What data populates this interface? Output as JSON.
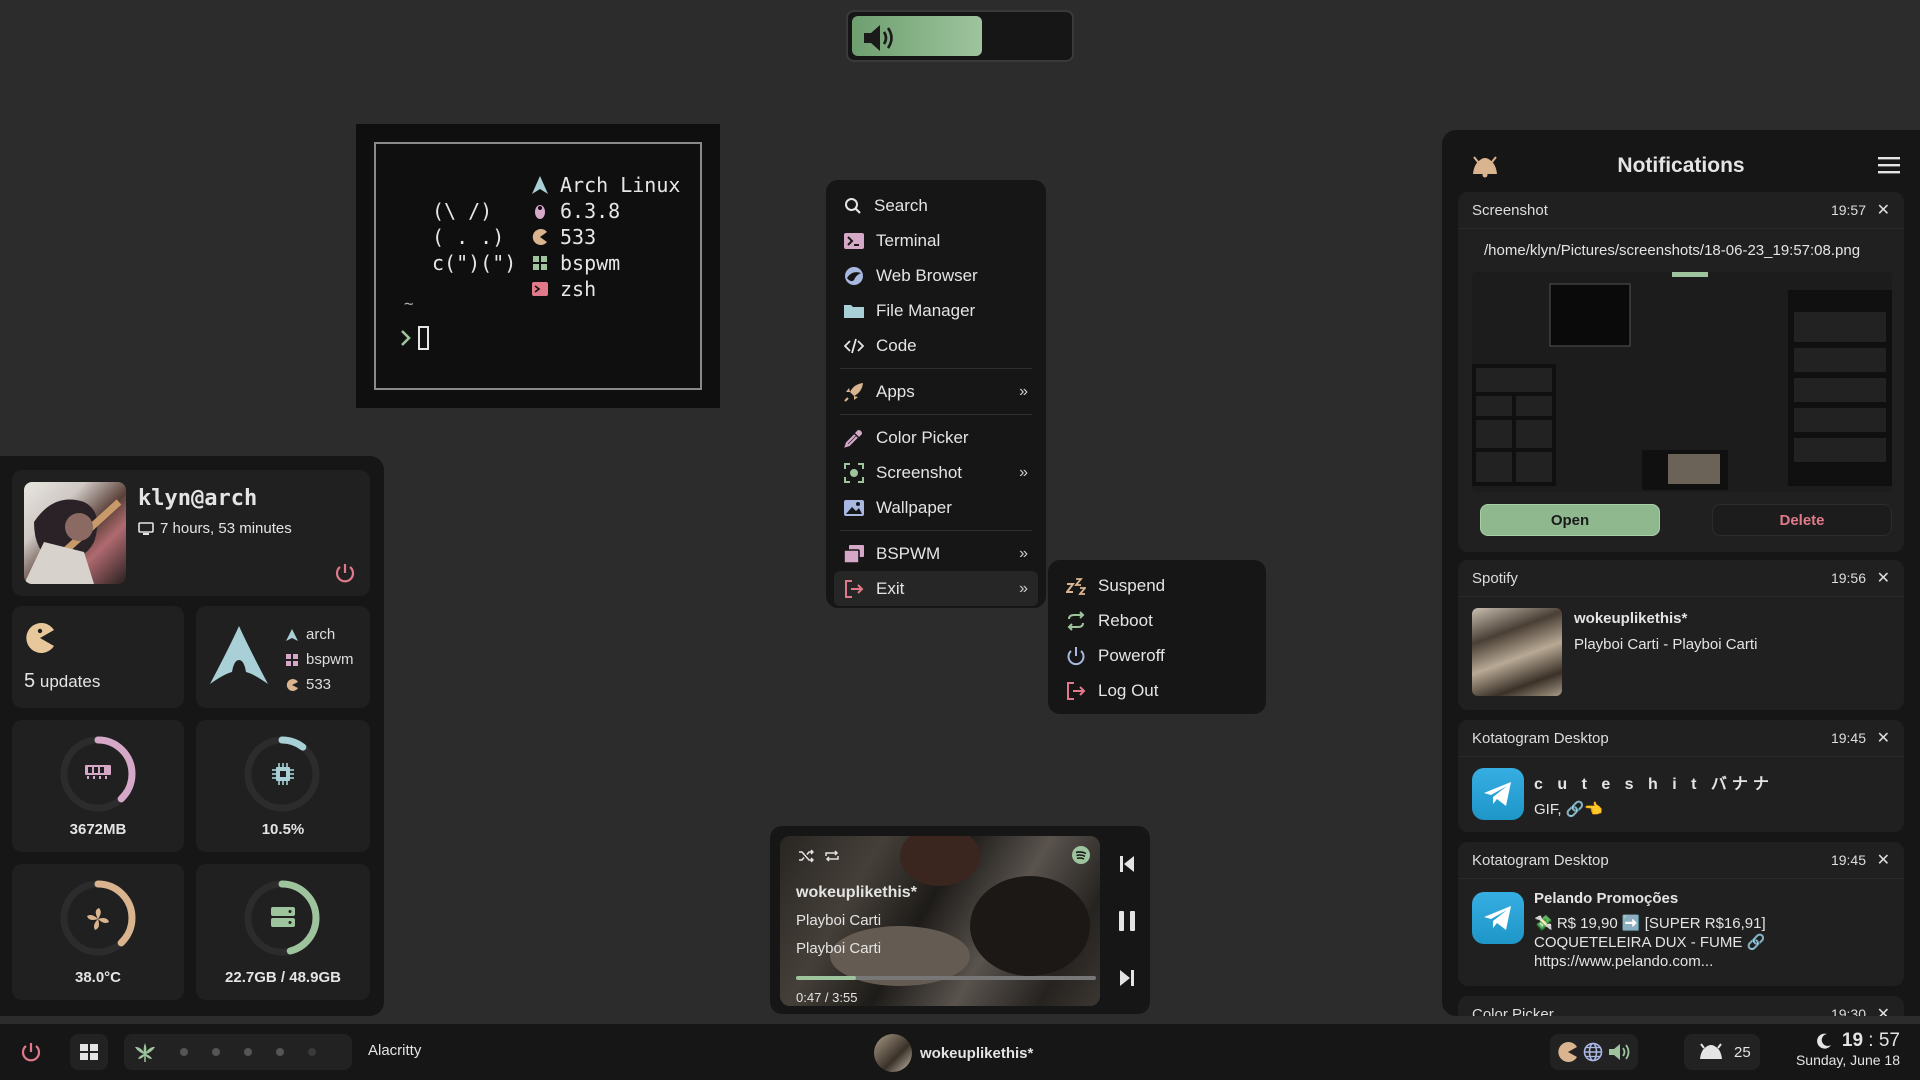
{
  "volume_osd": {
    "level": 0.6,
    "icon": "speaker-icon",
    "color": "#9ec49e"
  },
  "terminal": {
    "bunny": [
      "(\\ /)",
      "( . .)",
      "c(\")(\")"
    ],
    "info": [
      {
        "icon": "arch-icon",
        "text": "Arch Linux"
      },
      {
        "icon": "kernel-icon",
        "text": "6.3.8"
      },
      {
        "icon": "package-icon",
        "text": "533"
      },
      {
        "icon": "wm-icon",
        "text": "bspwm"
      },
      {
        "icon": "shell-icon",
        "text": "zsh"
      }
    ],
    "cwd": "~",
    "prompt": ">"
  },
  "profile": {
    "username": "klyn@arch",
    "uptime": "7 hours, 53 minutes"
  },
  "updates": {
    "count": "5",
    "label": "updates"
  },
  "sysinfo": {
    "distro": "arch",
    "wm": "bspwm",
    "packages": "533"
  },
  "gauges": {
    "ram": {
      "value": "3672MB",
      "percent": 0.38,
      "color": "#d6a8c8"
    },
    "cpu": {
      "value": "10.5%",
      "percent": 0.105,
      "color": "#a8d0d6"
    },
    "temp": {
      "value": "38.0°C",
      "percent": 0.38,
      "color": "#d9b48f"
    },
    "disk": {
      "value": "22.7GB / 48.9GB",
      "percent": 0.46,
      "color": "#9ec49e"
    }
  },
  "menu": {
    "items": [
      {
        "label": "Search",
        "icon": "search-icon"
      },
      {
        "label": "Terminal",
        "icon": "terminal-icon"
      },
      {
        "label": "Web Browser",
        "icon": "browser-icon"
      },
      {
        "label": "File Manager",
        "icon": "folder-icon"
      },
      {
        "label": "Code",
        "icon": "code-icon"
      },
      {
        "label": "Apps",
        "icon": "rocket-icon",
        "submenu": true
      },
      {
        "label": "Color Picker",
        "icon": "eyedropper-icon"
      },
      {
        "label": "Screenshot",
        "icon": "screenshot-icon",
        "submenu": true
      },
      {
        "label": "Wallpaper",
        "icon": "image-icon"
      },
      {
        "label": "BSPWM",
        "icon": "windows-icon",
        "submenu": true
      },
      {
        "label": "Exit",
        "icon": "exit-icon",
        "submenu": true
      }
    ],
    "arrow": "»"
  },
  "exit_menu": {
    "items": [
      {
        "label": "Suspend",
        "icon": "sleep-icon"
      },
      {
        "label": "Reboot",
        "icon": "reboot-icon"
      },
      {
        "label": "Poweroff",
        "icon": "power-icon"
      },
      {
        "label": "Log Out",
        "icon": "logout-icon"
      }
    ]
  },
  "music": {
    "title": "wokeuplikethis*",
    "artist": "Playboi Carti",
    "album": "Playboi Carti",
    "time": "0:47 / 3:55",
    "progress": 0.2
  },
  "notifications": {
    "title": "Notifications",
    "items": [
      {
        "app": "Screenshot",
        "time": "19:57",
        "body": "/home/klyn/Pictures/screenshots/18-06-23_19:57:08.png",
        "open": "Open",
        "delete": "Delete"
      },
      {
        "app": "Spotify",
        "time": "19:56",
        "title": "wokeuplikethis*",
        "body": "Playboi Carti - Playboi Carti"
      },
      {
        "app": "Kotatogram Desktop",
        "time": "19:45",
        "title": "c u t e s h i t バナナ",
        "body": "GIF, 🔗👈"
      },
      {
        "app": "Kotatogram Desktop",
        "time": "19:45",
        "title": "Pelando Promoções",
        "body": "💸 R$ 19,90 ➡️ [SUPER R$16,91] COQUETELEIRA DUX - FUME 🔗 https://www.pelando.com..."
      },
      {
        "app": "Color Picker",
        "time": "19:30"
      }
    ],
    "close": "✕"
  },
  "taskbar": {
    "window_title": "Alacritty",
    "now_playing": "wokeuplikethis*",
    "notif_count": "25",
    "time_h": "19",
    "time_m": "57",
    "date": "Sunday, June 18"
  }
}
